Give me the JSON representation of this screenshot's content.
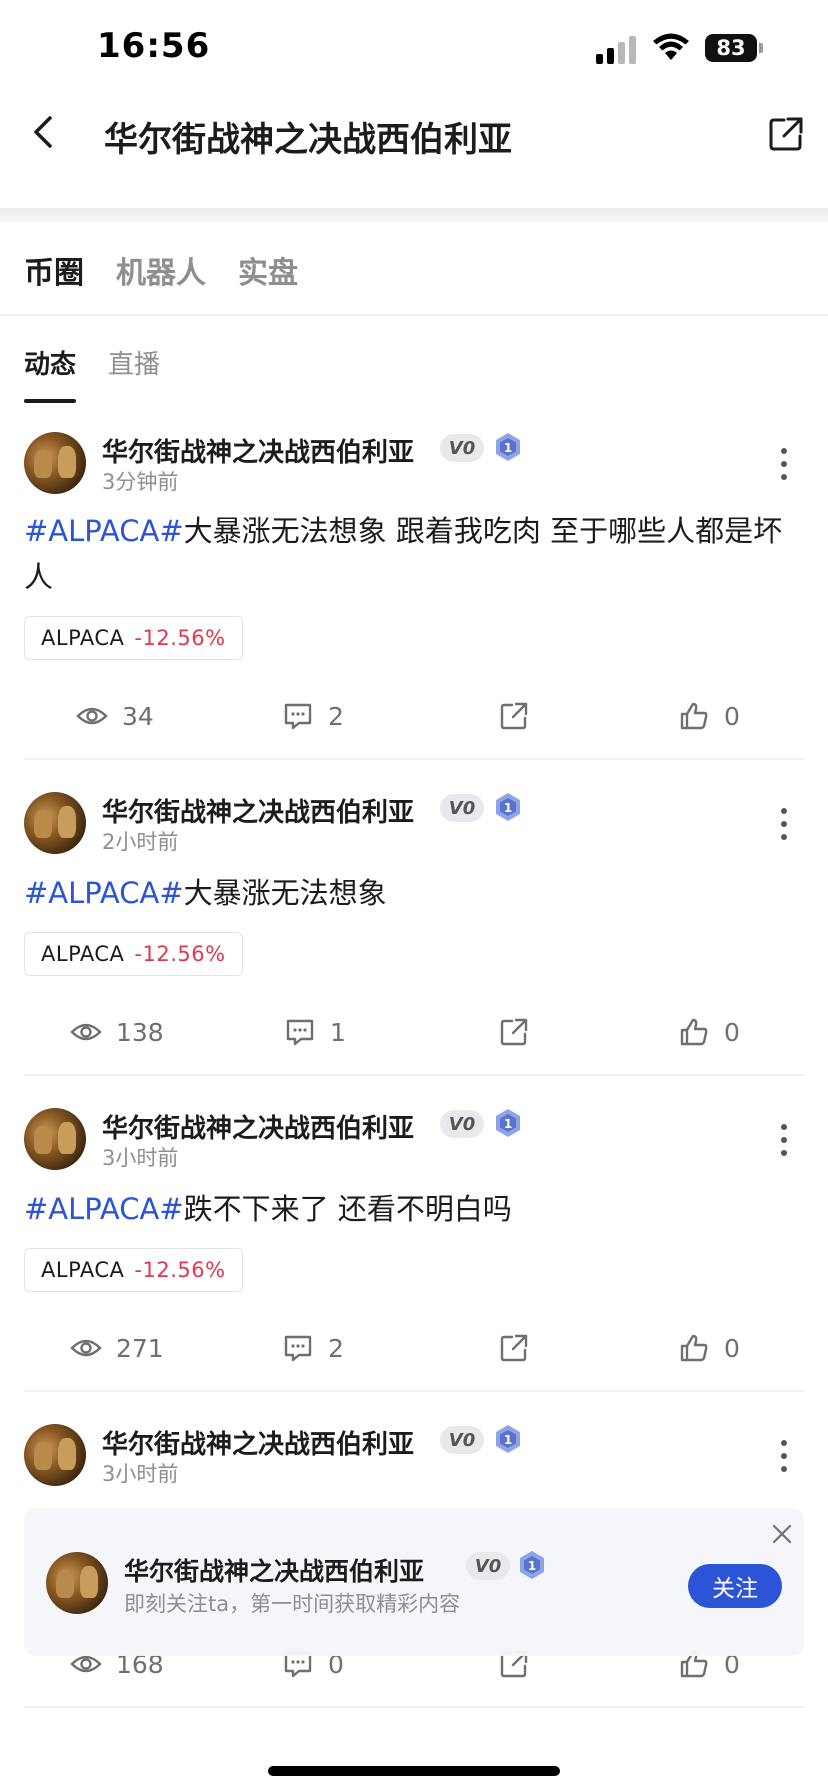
{
  "status_bar": {
    "time": "16:56",
    "battery": "83"
  },
  "header": {
    "title": "华尔街战神之决战西伯利亚"
  },
  "main_tabs": [
    {
      "label": "币圈",
      "active": true
    },
    {
      "label": "机器人",
      "active": false
    },
    {
      "label": "实盘",
      "active": false
    }
  ],
  "sub_tabs": [
    {
      "label": "动态",
      "active": true
    },
    {
      "label": "直播",
      "active": false
    }
  ],
  "posts": [
    {
      "author": "华尔街战神之决战西伯利亚",
      "badge": "V0",
      "level": "1",
      "time": "3分钟前",
      "hashtag": "#ALPACA#",
      "text": "大暴涨无法想象 跟着我吃肉 至于哪些人都是坏人",
      "coin": "ALPACA",
      "change": "-12.56%",
      "views": "34",
      "comments": "2",
      "likes": "0"
    },
    {
      "author": "华尔街战神之决战西伯利亚",
      "badge": "V0",
      "level": "1",
      "time": "2小时前",
      "hashtag": "#ALPACA#",
      "text": "大暴涨无法想象",
      "coin": "ALPACA",
      "change": "-12.56%",
      "views": "138",
      "comments": "1",
      "likes": "0"
    },
    {
      "author": "华尔街战神之决战西伯利亚",
      "badge": "V0",
      "level": "1",
      "time": "3小时前",
      "hashtag": "#ALPACA#",
      "text": "跌不下来了 还看不明白吗",
      "coin": "ALPACA",
      "change": "-12.56%",
      "views": "271",
      "comments": "2",
      "likes": "0"
    },
    {
      "author": "华尔街战神之决战西伯利亚",
      "badge": "V0",
      "level": "1",
      "time": "3小时前",
      "views": "168",
      "comments": "0",
      "likes": "0"
    }
  ],
  "follow_popup": {
    "name": "华尔街战神之决战西伯利亚",
    "badge": "V0",
    "level": "1",
    "subtitle": "即刻关注ta，第一时间获取精彩内容",
    "button": "关注"
  },
  "colors": {
    "accent": "#2b54d6",
    "negative": "#e0384f"
  }
}
